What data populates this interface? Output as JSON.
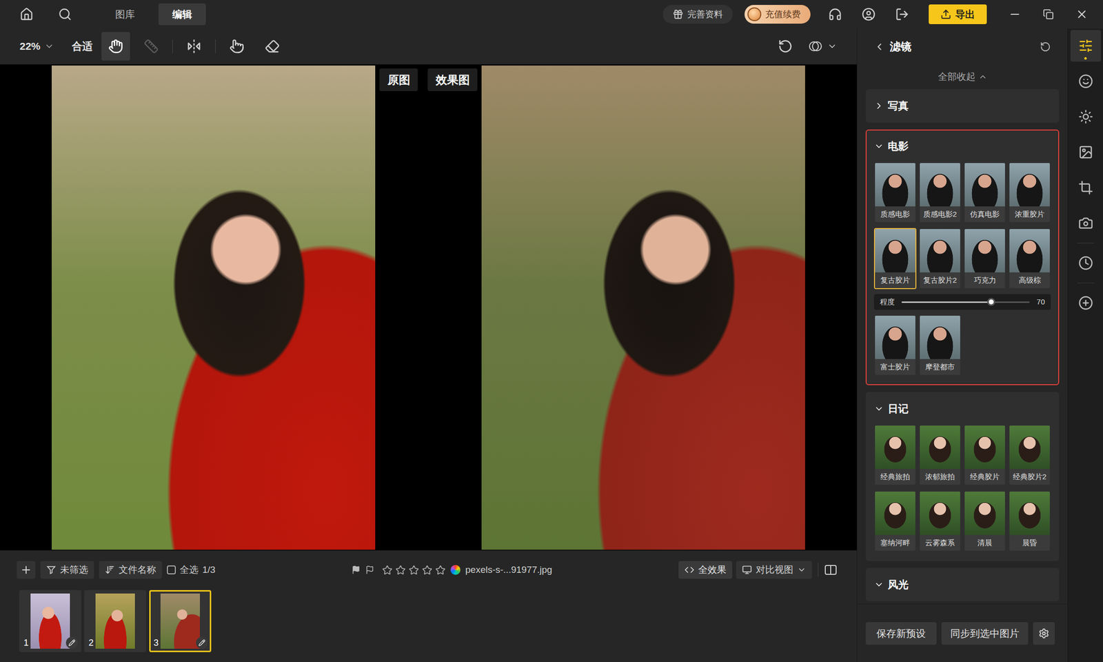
{
  "top_bar": {
    "tabs": [
      {
        "label": "图库",
        "selected": false
      },
      {
        "label": "编辑",
        "selected": true
      }
    ],
    "profile_button": "完善资料",
    "recharge_button": "充值续费",
    "export_button": "导出"
  },
  "toolbar": {
    "zoom": "22%",
    "fit_button": "合适",
    "tools": [
      {
        "selected": true,
        "disabled": false
      },
      {
        "selected": false,
        "disabled": true
      },
      {
        "selected": false,
        "disabled": false
      },
      {
        "selected": false,
        "disabled": false
      },
      {
        "selected": false,
        "disabled": false
      }
    ]
  },
  "canvas": {
    "views": [
      {
        "label": "原图"
      },
      {
        "label": "效果图"
      }
    ]
  },
  "bottom_bar": {
    "filter_button": "未筛选",
    "sort_button": "文件名称",
    "select_all": {
      "label": "全选",
      "checked": false
    },
    "count": "1/3",
    "stars": 0,
    "filename": "pexels-s-...91977.jpg",
    "effect_button": "全效果",
    "view_select": "对比视图"
  },
  "thumbnails": [
    {
      "number": "1",
      "selected": false,
      "edited": true
    },
    {
      "number": "2",
      "selected": false,
      "edited": false
    },
    {
      "number": "3",
      "selected": true,
      "edited": true
    }
  ],
  "filter_panel": {
    "title": "滤镜",
    "collapse_all": "全部收起",
    "sections": [
      {
        "title": "写真",
        "expanded": false,
        "highlighted": false,
        "items": []
      },
      {
        "title": "电影",
        "expanded": true,
        "highlighted": true,
        "items": [
          {
            "label": "质感电影",
            "selected": false
          },
          {
            "label": "质感电影2",
            "selected": false
          },
          {
            "label": "仿真电影",
            "selected": false
          },
          {
            "label": "浓重胶片",
            "selected": false
          },
          {
            "label": "复古胶片",
            "selected": true
          },
          {
            "label": "复古胶片2",
            "selected": false
          },
          {
            "label": "巧克力",
            "selected": false
          },
          {
            "label": "高级棕",
            "selected": false
          },
          {
            "label": "富士胶片",
            "selected": false
          },
          {
            "label": "摩登都市",
            "selected": false
          }
        ],
        "intensity": {
          "label": "程度",
          "value": "70",
          "level": 0.7
        }
      },
      {
        "title": "日记",
        "expanded": true,
        "highlighted": false,
        "items": [
          {
            "label": "经典旅拍",
            "selected": false
          },
          {
            "label": "浓郁旅拍",
            "selected": false
          },
          {
            "label": "经典胶片",
            "selected": false
          },
          {
            "label": "经典胶片2",
            "selected": false
          },
          {
            "label": "塞纳河畔",
            "selected": false
          },
          {
            "label": "云雾森系",
            "selected": false
          },
          {
            "label": "清晨",
            "selected": false
          },
          {
            "label": "晨昏",
            "selected": false
          }
        ]
      },
      {
        "title": "风光",
        "expanded": true,
        "highlighted": false,
        "items": []
      }
    ],
    "save_preset_button": "保存新预设",
    "sync_button": "同步到选中图片"
  },
  "right_rail": [
    {
      "selected": true
    },
    {
      "selected": false
    },
    {
      "selected": false
    },
    {
      "selected": false
    },
    {
      "selected": false
    },
    {
      "selected": false
    },
    {
      "selected": false
    },
    {
      "selected": false
    }
  ]
}
